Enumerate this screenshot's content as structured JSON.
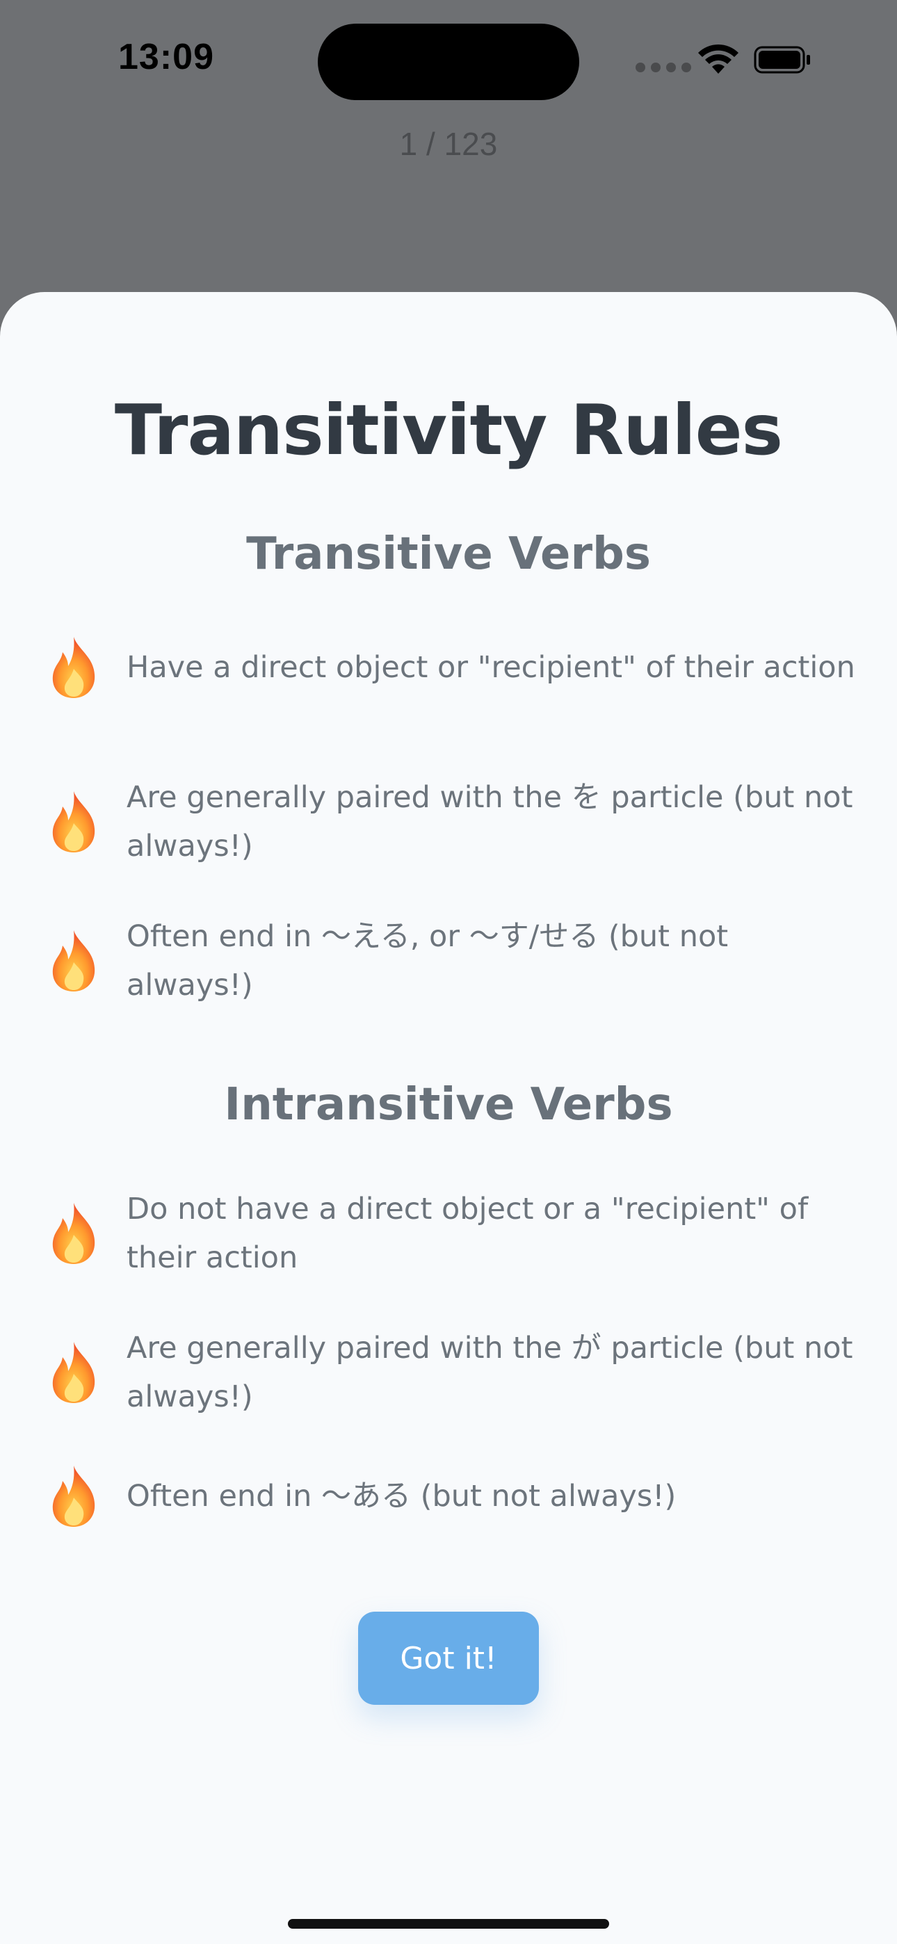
{
  "status_bar": {
    "time": "13:09"
  },
  "header": {
    "page_counter": "1 / 123"
  },
  "sheet": {
    "title": "Transitivity Rules",
    "sections": [
      {
        "title": "Transitive Verbs",
        "rules": [
          "Have a direct object or \"recipient\" of their action",
          "Are generally paired with the を particle (but not always!)",
          "Often end in 〜える, or 〜す/せる (but not always!)"
        ]
      },
      {
        "title": "Intransitive Verbs",
        "rules": [
          "Do not have a direct object or a \"recipient\" of their action",
          "Are generally paired with the が particle (but not always!)",
          "Often end in 〜ある (but not always!)"
        ]
      }
    ],
    "button_label": "Got it!"
  },
  "icons": {
    "rule_icon": "fire-icon"
  },
  "colors": {
    "sheet_background": "#f8fafc",
    "title": "#323a43",
    "section_title": "#68717a",
    "body_text": "#6c747c",
    "button": "#68ade9",
    "overlay": "#6e7073"
  }
}
